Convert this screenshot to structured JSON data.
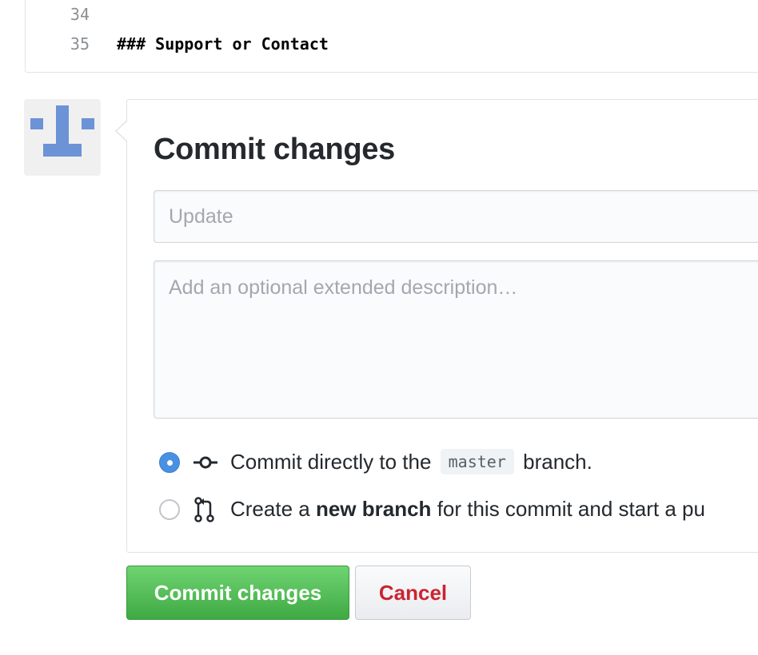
{
  "code": {
    "lines": [
      {
        "number": "34",
        "text": ""
      },
      {
        "number": "35",
        "text": "### Support or Contact"
      }
    ]
  },
  "avatar": {
    "icon": "identicon-icon",
    "color": "#6b93d6"
  },
  "commit_form": {
    "title": "Commit changes",
    "summary_placeholder": "Update",
    "summary_value": "",
    "description_placeholder": "Add an optional extended description…",
    "description_value": "",
    "options": {
      "direct": {
        "selected": true,
        "icon": "git-commit-icon",
        "text_before": "Commit directly to the",
        "branch": "master",
        "text_after": "branch."
      },
      "new_branch": {
        "selected": false,
        "icon": "git-pull-request-icon",
        "text_before": "Create a",
        "text_bold": "new branch",
        "text_after": "for this commit and start a pu"
      }
    }
  },
  "buttons": {
    "commit_label": "Commit changes",
    "cancel_label": "Cancel"
  },
  "colors": {
    "accent": "#4a90e2",
    "commit_button": "#44b347",
    "cancel_text": "#cb2431"
  }
}
